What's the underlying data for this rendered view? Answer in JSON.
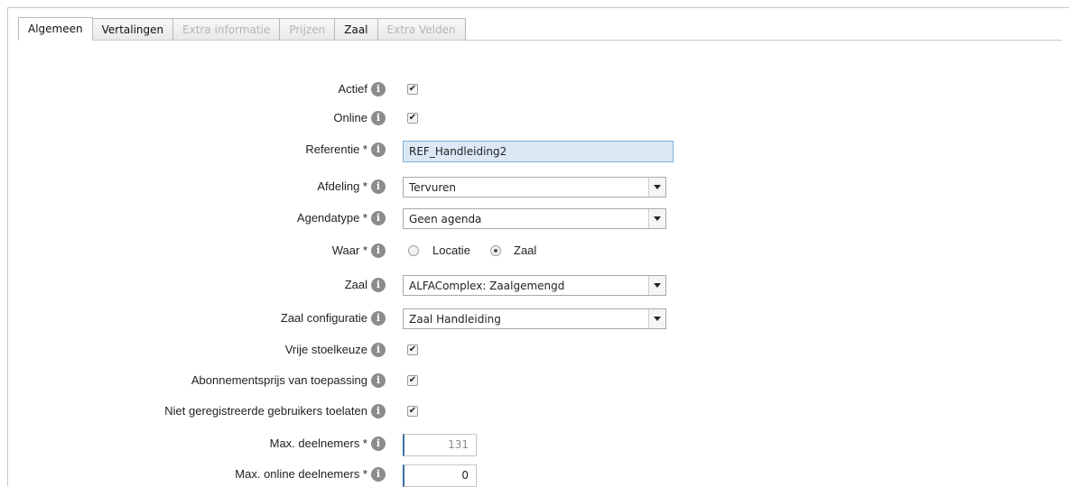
{
  "tabs": [
    {
      "label": "Algemeen",
      "state": "active"
    },
    {
      "label": "Vertalingen",
      "state": "enabled"
    },
    {
      "label": "Extra informatie",
      "state": "disabled"
    },
    {
      "label": "Prijzen",
      "state": "disabled"
    },
    {
      "label": "Zaal",
      "state": "enabled"
    },
    {
      "label": "Extra Velden",
      "state": "disabled"
    }
  ],
  "form": {
    "actief": {
      "label": "Actief",
      "checked": true
    },
    "online": {
      "label": "Online",
      "checked": true
    },
    "referentie": {
      "label": "Referentie *",
      "value": "REF_Handleiding2"
    },
    "afdeling": {
      "label": "Afdeling *",
      "value": "Tervuren"
    },
    "agendatype": {
      "label": "Agendatype *",
      "value": "Geen agenda"
    },
    "waar": {
      "label": "Waar *",
      "options": [
        {
          "label": "Locatie",
          "selected": false
        },
        {
          "label": "Zaal",
          "selected": true
        }
      ]
    },
    "zaal": {
      "label": "Zaal",
      "value": "ALFAComplex: Zaalgemengd"
    },
    "zaal_configuratie": {
      "label": "Zaal configuratie",
      "value": "Zaal Handleiding"
    },
    "vrije_stoelkeuze": {
      "label": "Vrije stoelkeuze",
      "checked": true
    },
    "abonnementsprijs": {
      "label": "Abonnementsprijs van toepassing",
      "checked": true
    },
    "niet_geregistreerde": {
      "label": "Niet geregistreerde gebruikers toelaten",
      "checked": true
    },
    "max_deelnemers": {
      "label": "Max. deelnemers *",
      "value": "131"
    },
    "max_online_deelnemers": {
      "label": "Max. online deelnemers *",
      "value": "0"
    }
  },
  "icons": {
    "info": "info-icon",
    "check": "✔",
    "info_glyph": "i"
  },
  "colors": {
    "info_icon": "#8c8c8c",
    "focused_input": "#dce9f5",
    "input_accent": "#3a6ea5"
  }
}
